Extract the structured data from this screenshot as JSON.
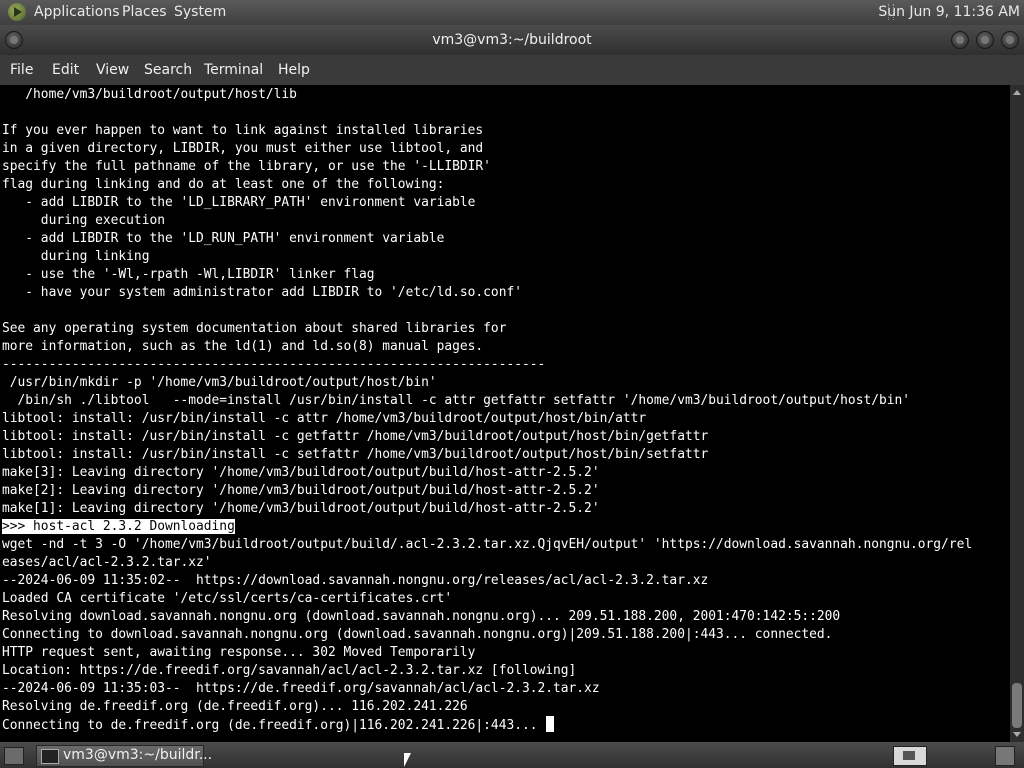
{
  "top_panel": {
    "menus": [
      "Applications",
      "Places",
      "System"
    ],
    "clock": "Sun Jun  9, 11:36 AM"
  },
  "window": {
    "title": "vm3@vm3:~/buildroot",
    "menus": [
      "File",
      "Edit",
      "View",
      "Search",
      "Terminal",
      "Help"
    ]
  },
  "terminal": {
    "lines": [
      "   /home/vm3/buildroot/output/host/lib",
      "",
      "If you ever happen to want to link against installed libraries",
      "in a given directory, LIBDIR, you must either use libtool, and",
      "specify the full pathname of the library, or use the '-LLIBDIR'",
      "flag during linking and do at least one of the following:",
      "   - add LIBDIR to the 'LD_LIBRARY_PATH' environment variable",
      "     during execution",
      "   - add LIBDIR to the 'LD_RUN_PATH' environment variable",
      "     during linking",
      "   - use the '-Wl,-rpath -Wl,LIBDIR' linker flag",
      "   - have your system administrator add LIBDIR to '/etc/ld.so.conf'",
      "",
      "See any operating system documentation about shared libraries for",
      "more information, such as the ld(1) and ld.so(8) manual pages.",
      "----------------------------------------------------------------------",
      " /usr/bin/mkdir -p '/home/vm3/buildroot/output/host/bin'",
      "  /bin/sh ./libtool   --mode=install /usr/bin/install -c attr getfattr setfattr '/home/vm3/buildroot/output/host/bin'",
      "libtool: install: /usr/bin/install -c attr /home/vm3/buildroot/output/host/bin/attr",
      "libtool: install: /usr/bin/install -c getfattr /home/vm3/buildroot/output/host/bin/getfattr",
      "libtool: install: /usr/bin/install -c setfattr /home/vm3/buildroot/output/host/bin/setfattr",
      "make[3]: Leaving directory '/home/vm3/buildroot/output/build/host-attr-2.5.2'",
      "make[2]: Leaving directory '/home/vm3/buildroot/output/build/host-attr-2.5.2'",
      "make[1]: Leaving directory '/home/vm3/buildroot/output/build/host-attr-2.5.2'",
      ">>> host-acl 2.3.2 Downloading",
      "wget -nd -t 3 -O '/home/vm3/buildroot/output/build/.acl-2.3.2.tar.xz.QjqvEH/output' 'https://download.savannah.nongnu.org/rel",
      "eases/acl/acl-2.3.2.tar.xz'",
      "--2024-06-09 11:35:02--  https://download.savannah.nongnu.org/releases/acl/acl-2.3.2.tar.xz",
      "Loaded CA certificate '/etc/ssl/certs/ca-certificates.crt'",
      "Resolving download.savannah.nongnu.org (download.savannah.nongnu.org)... 209.51.188.200, 2001:470:142:5::200",
      "Connecting to download.savannah.nongnu.org (download.savannah.nongnu.org)|209.51.188.200|:443... connected.",
      "HTTP request sent, awaiting response... 302 Moved Temporarily",
      "Location: https://de.freedif.org/savannah/acl/acl-2.3.2.tar.xz [following]",
      "--2024-06-09 11:35:03--  https://de.freedif.org/savannah/acl/acl-2.3.2.tar.xz",
      "Resolving de.freedif.org (de.freedif.org)... 116.202.241.226",
      "Connecting to de.freedif.org (de.freedif.org)|116.202.241.226|:443... "
    ],
    "highlighted_line": 24
  },
  "taskbar": {
    "task_label": "vm3@vm3:~/buildr..."
  },
  "icons": {
    "apps": "applications-icon",
    "close": "close-icon",
    "maximize": "maximize-icon",
    "minimize": "minimize-icon",
    "show_desktop": "show-desktop-icon",
    "terminal": "terminal-icon",
    "workspace": "workspace-switcher-icon",
    "trash": "trash-icon"
  }
}
